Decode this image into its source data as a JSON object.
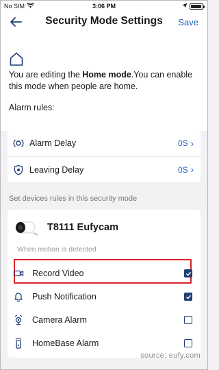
{
  "status_bar": {
    "carrier": "No SIM",
    "time": "3:06 PM",
    "battery_level": 0.92
  },
  "header": {
    "title": "Security Mode Settings",
    "save_label": "Save"
  },
  "mode": {
    "prefix": "You are editing the ",
    "mode_name": "Home mode",
    "suffix": ".You can enable this mode when people are home."
  },
  "alarm_rules": {
    "label": "Alarm rules:",
    "items": [
      {
        "label": "Alarm Delay",
        "value": "0S",
        "icon": "alarm-delay-icon"
      },
      {
        "label": "Leaving Delay",
        "value": "0S",
        "icon": "shield-icon"
      }
    ]
  },
  "device_rules": {
    "label": "Set devices rules in this security mode",
    "device_name": "T8111 Eufycam",
    "note": "When motion is detected",
    "items": [
      {
        "label": "Record Video",
        "checked": true,
        "icon": "video-camera-icon"
      },
      {
        "label": "Push Notification",
        "checked": true,
        "icon": "bell-icon"
      },
      {
        "label": "Camera Alarm",
        "checked": false,
        "icon": "camera-alarm-icon"
      },
      {
        "label": "HomeBase Alarm",
        "checked": false,
        "icon": "homebase-alarm-icon"
      }
    ]
  },
  "colors": {
    "accent": "#1f5fc2",
    "checkbox": "#1f3e73",
    "highlight": "#d9232d"
  },
  "source_text": "source: eufy.com"
}
